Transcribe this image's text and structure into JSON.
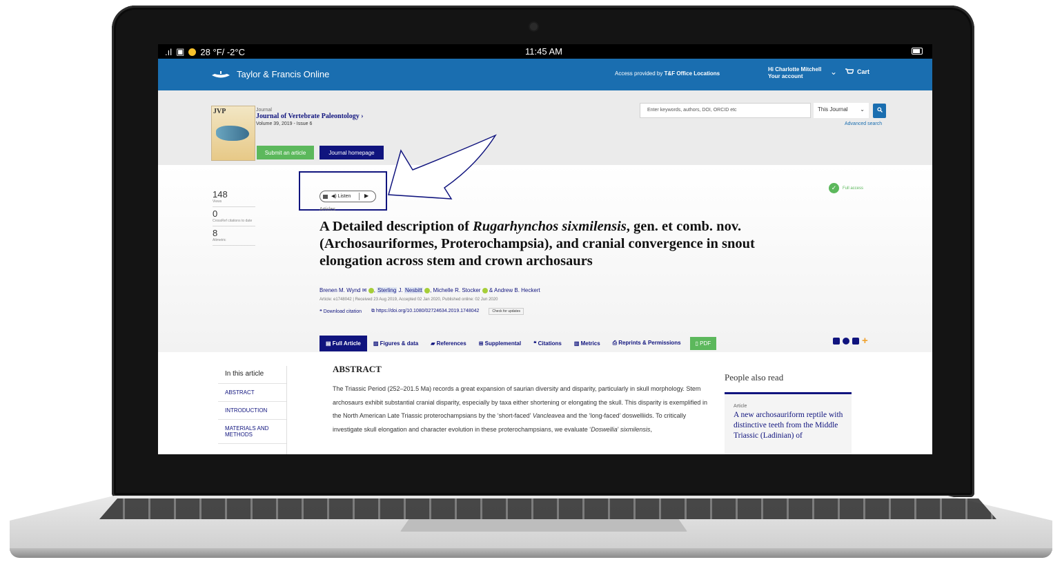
{
  "status": {
    "weather": "28 °F/ -2°C",
    "time": "11:45 AM"
  },
  "header": {
    "brand": "Taylor & Francis Online",
    "access_prefix": "Access provided by",
    "access_org": "T&F Office Locations",
    "greeting": "Hi Charlotte Mitchell",
    "account": "Your account",
    "cart": "Cart"
  },
  "journal": {
    "cover_label": "JVP",
    "label": "Journal",
    "name": "Journal of Vertebrate Paleontology",
    "volume": "Volume 39, 2019 - Issue 6",
    "submit": "Submit an article",
    "homepage": "Journal homepage"
  },
  "search": {
    "placeholder": "Enter keywords, authors, DOI, ORCID etc",
    "scope": "This Journal",
    "advanced": "Advanced search"
  },
  "metrics": [
    {
      "value": "148",
      "label": "Views"
    },
    {
      "value": "0",
      "label": "CrossRef citations to date"
    },
    {
      "value": "8",
      "label": "Altmetric"
    }
  ],
  "listen": {
    "label": "Listen",
    "play": "▶"
  },
  "access": {
    "label": "Full access"
  },
  "article": {
    "type": "Articles",
    "title_a": "A Detailed description of ",
    "title_italic": "Rugarhynchos sixmilensis",
    "title_b": ", gen. et comb. nov. (Archosauriformes, Proterochampsia), and cranial convergence in snout elongation across stem and crown archosaurs",
    "author1": "Brenen M. Wynd",
    "author2_first": "Sterling",
    "author2_mid": " J. ",
    "author2_last": "Nesbitt",
    "author3": ", Michelle R. Stocker",
    "author4": " & Andrew B. Heckert",
    "meta": "Article: e1748042 | Received 23 Aug 2019, Accepted 02 Jan 2020, Published online: 02 Jun 2020",
    "download": "Download citation",
    "doi": "https://doi.org/10.1080/02724634.2019.1748042",
    "updates": "Check for updates"
  },
  "tabs": [
    "Full Article",
    "Figures & data",
    "References",
    "Supplemental",
    "Citations",
    "Metrics",
    "Reprints & Permissions",
    "PDF"
  ],
  "toc": {
    "heading": "In this article",
    "items": [
      "ABSTRACT",
      "INTRODUCTION",
      "MATERIALS AND METHODS"
    ]
  },
  "abstract": {
    "heading": "ABSTRACT",
    "t1": "The Triassic Period (252–201.5 Ma) records a great expansion of saurian diversity and disparity, particularly in skull morphology. Stem archosaurs exhibit substantial cranial disparity, especially by taxa either shortening or elongating the skull. This disparity is exemplified in the North American Late Triassic proterochampsians by the ‘short-faced’ ",
    "i1": "Vancleavea",
    "t2": " and the ‘long-faced’ doswelliids. To critically investigate skull elongation and character evolution in these proterochampsians, we evaluate ‘",
    "i2": "Doswellia",
    "t3": "’ ",
    "i3": "sixmilensis",
    "t4": ","
  },
  "sidebar": {
    "heading": "People also read",
    "card_kind": "Article",
    "card_title": "A new archosauriform reptile with distinctive teeth from the Middle Triassic (Ladinian) of"
  },
  "colors": {
    "brand_blue": "#1a6eb0",
    "navy": "#10147e",
    "green": "#5cb85c"
  }
}
